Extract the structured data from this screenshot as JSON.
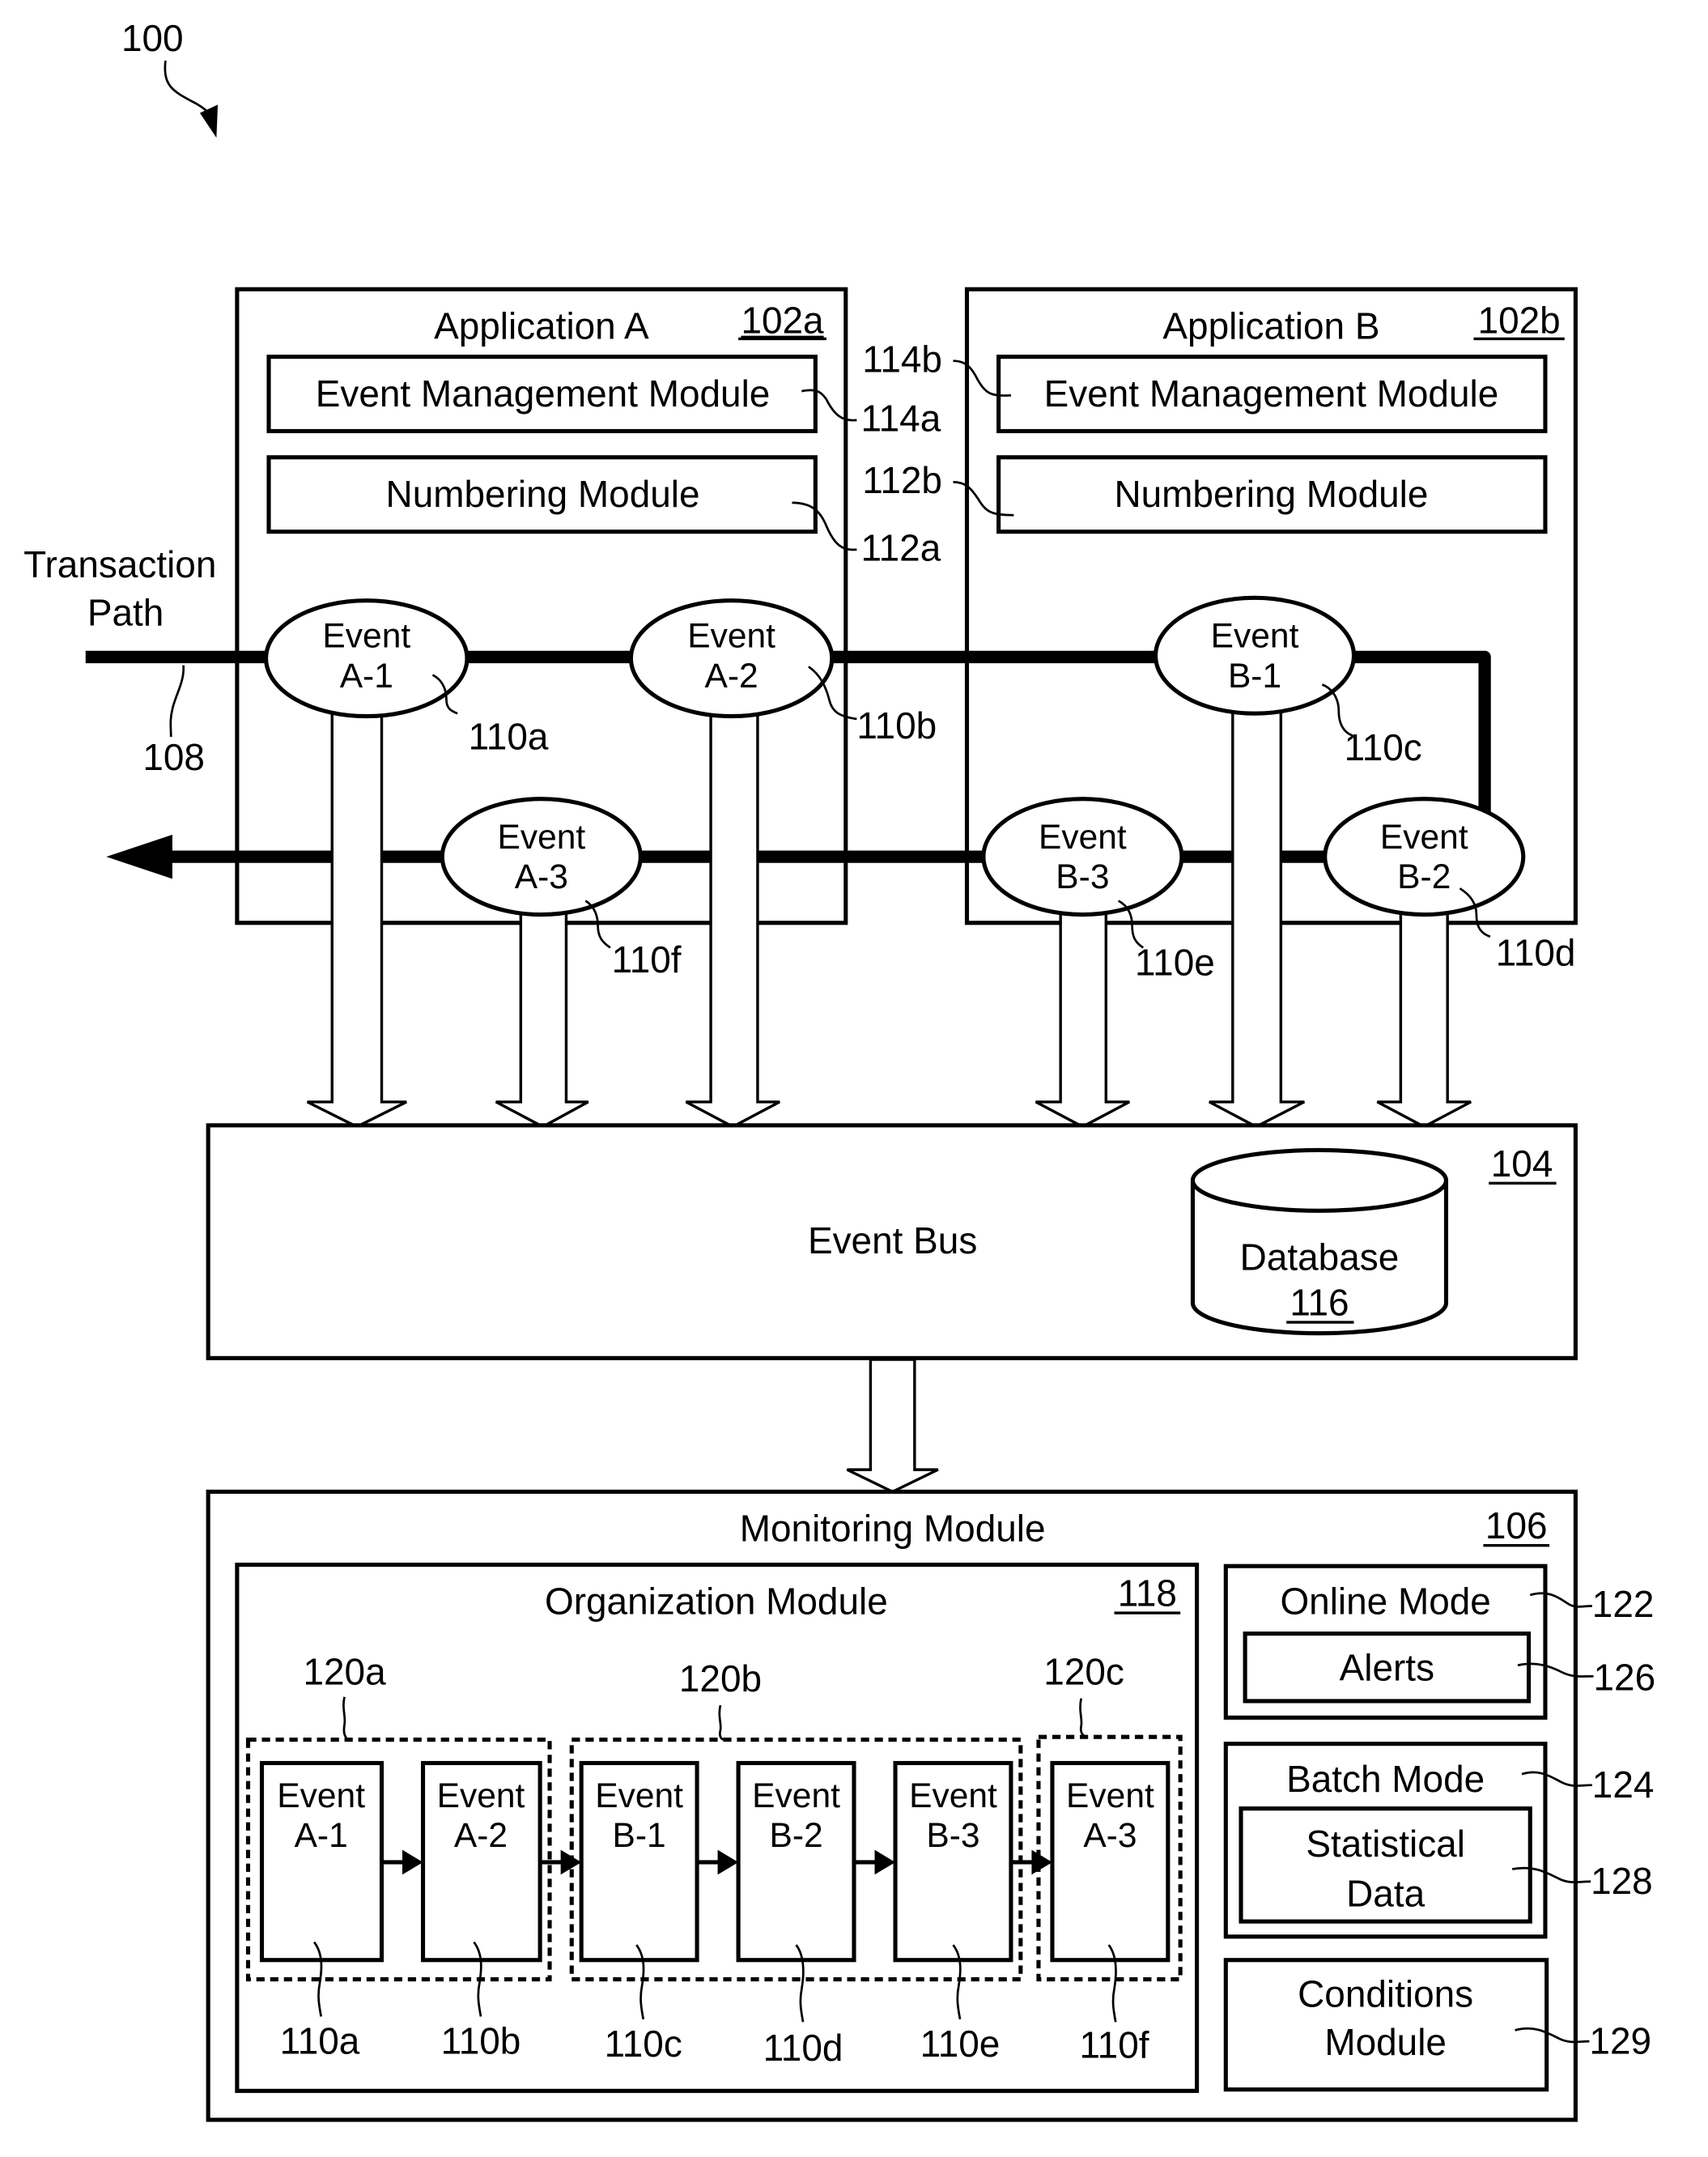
{
  "figure": {
    "ref": "100"
  },
  "transaction_path": {
    "label_line1": "Transaction",
    "label_line2": "Path",
    "ref": "108"
  },
  "application_a": {
    "title": "Application A",
    "ref": "102a",
    "event_management": {
      "label": "Event Management Module",
      "ref": "114a"
    },
    "numbering": {
      "label": "Numbering Module",
      "ref": "112a"
    }
  },
  "application_b": {
    "title": "Application B",
    "ref": "102b",
    "event_management": {
      "label": "Event Management Module",
      "ref": "114b"
    },
    "numbering": {
      "label": "Numbering Module",
      "ref": "112b"
    }
  },
  "events": [
    {
      "line1": "Event",
      "line2": "A-1",
      "ref": "110a"
    },
    {
      "line1": "Event",
      "line2": "A-2",
      "ref": "110b"
    },
    {
      "line1": "Event",
      "line2": "B-1",
      "ref": "110c"
    },
    {
      "line1": "Event",
      "line2": "B-2",
      "ref": "110d"
    },
    {
      "line1": "Event",
      "line2": "B-3",
      "ref": "110e"
    },
    {
      "line1": "Event",
      "line2": "A-3",
      "ref": "110f"
    }
  ],
  "event_bus": {
    "label": "Event Bus",
    "ref": "104",
    "database": {
      "label": "Database",
      "ref": "116"
    }
  },
  "monitoring_module": {
    "label": "Monitoring Module",
    "ref": "106",
    "organization": {
      "label": "Organization Module",
      "ref": "118",
      "groups": [
        {
          "ref": "120a"
        },
        {
          "ref": "120b"
        },
        {
          "ref": "120c"
        }
      ],
      "sequence": [
        {
          "line1": "Event",
          "line2": "A-1",
          "ref": "110a"
        },
        {
          "line1": "Event",
          "line2": "A-2",
          "ref": "110b"
        },
        {
          "line1": "Event",
          "line2": "B-1",
          "ref": "110c"
        },
        {
          "line1": "Event",
          "line2": "B-2",
          "ref": "110d"
        },
        {
          "line1": "Event",
          "line2": "B-3",
          "ref": "110e"
        },
        {
          "line1": "Event",
          "line2": "A-3",
          "ref": "110f"
        }
      ]
    },
    "online_mode": {
      "label": "Online Mode",
      "ref": "122",
      "alerts": {
        "label": "Alerts",
        "ref": "126"
      }
    },
    "batch_mode": {
      "label": "Batch Mode",
      "ref": "124",
      "statistical": {
        "line1": "Statistical",
        "line2": "Data",
        "ref": "128"
      }
    },
    "conditions": {
      "line1": "Conditions",
      "line2": "Module",
      "ref": "129"
    }
  }
}
